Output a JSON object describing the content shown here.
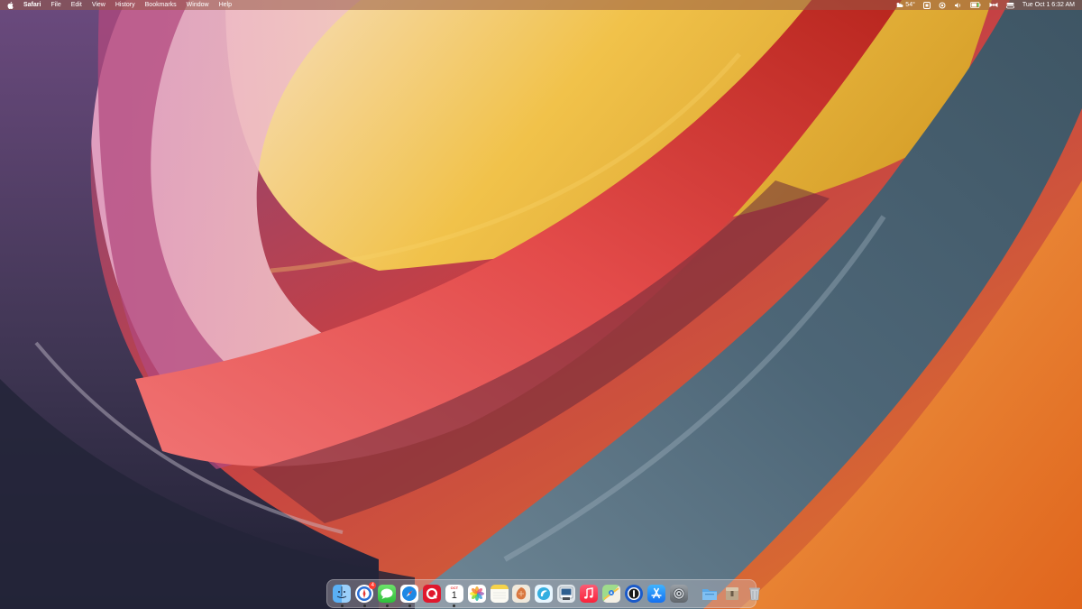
{
  "menubar": {
    "app_name": "Safari",
    "menus": [
      "File",
      "Edit",
      "View",
      "History",
      "Bookmarks",
      "Window",
      "Help"
    ],
    "weather": "54°",
    "clock": "Tue Oct 1  6:32 AM"
  },
  "dock": {
    "calendar": {
      "month": "OCT",
      "day": "1"
    },
    "mail_badge": "4",
    "apps": [
      "Finder",
      "Safari Technology Preview",
      "Messages",
      "Safari",
      "Readdle",
      "Calendar",
      "Photos",
      "Notes",
      "Claude",
      "Ivory",
      "Preview",
      "Music",
      "Maps",
      "1Password",
      "App Store",
      "System Settings"
    ]
  },
  "colors": {
    "menubar": "#965a46",
    "badge": "#ff3b30"
  }
}
